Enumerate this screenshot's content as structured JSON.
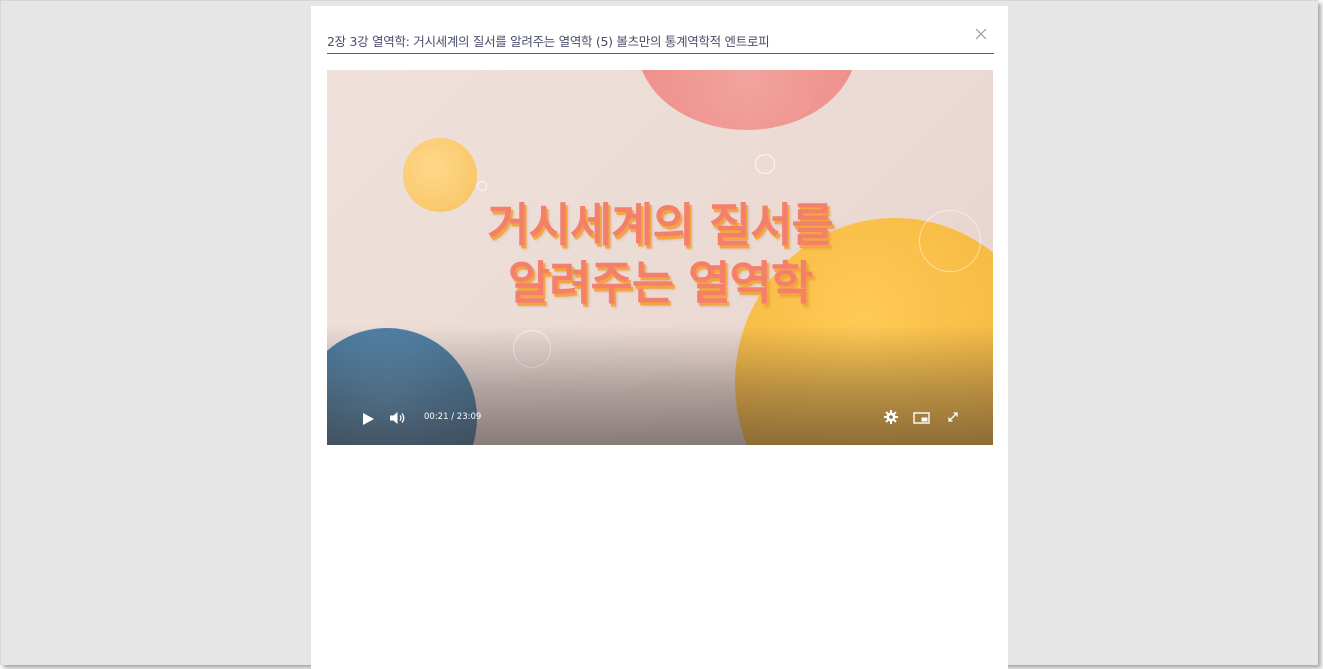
{
  "modal": {
    "title": "2장 3강 열역학: 거시세계의 질서를 알려주는 열역학 (5) 볼츠만의 통계역학적 엔트로피"
  },
  "video": {
    "headline_line1": "거시세계의 질서를",
    "headline_line2": "알려주는 열역학",
    "current_time": "00:21",
    "time_separator": "/",
    "duration": "23:09",
    "colors": {
      "headline": "#f4806c",
      "headline_shadow": "#f2a63e",
      "blob_pink": "#ee8f8c",
      "blob_yellow": "#f4b740",
      "blob_blue": "#3f6f93"
    }
  },
  "icons": {
    "close": "close-icon",
    "play": "play-icon",
    "volume": "volume-icon",
    "settings": "gear-icon",
    "pip": "picture-in-picture-icon",
    "fullscreen": "fullscreen-icon"
  }
}
